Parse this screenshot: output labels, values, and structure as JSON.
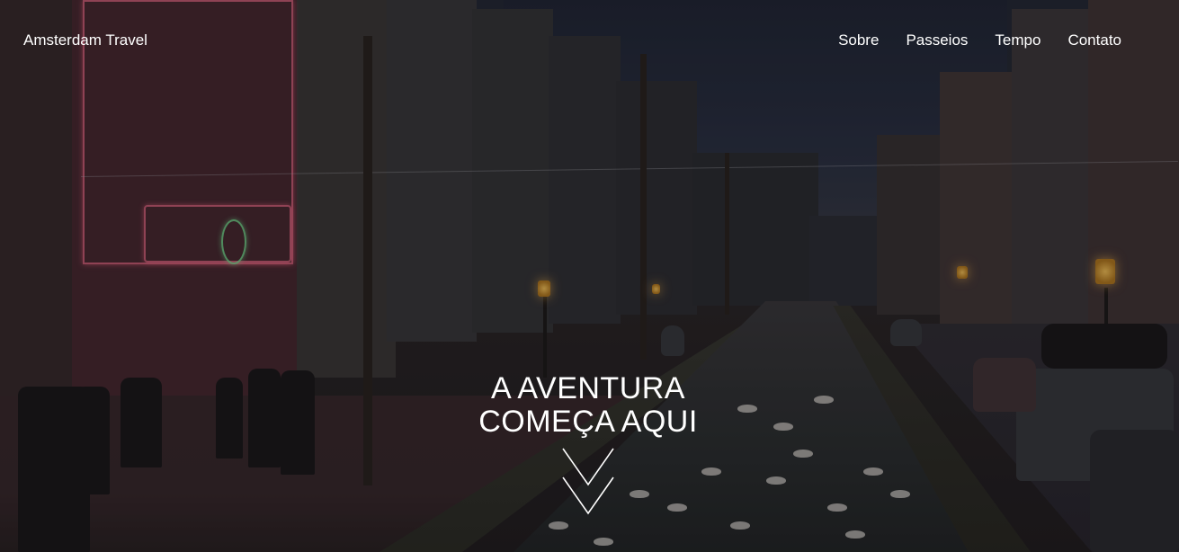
{
  "nav": {
    "brand": "Amsterdam Travel",
    "links": [
      "Sobre",
      "Passeios",
      "Tempo",
      "Contato"
    ]
  },
  "hero": {
    "headline_line1": "A AVENTURA",
    "headline_line2": "COMEÇA AQUI",
    "scroll_icon": "double-chevron-down-icon",
    "background_photo": "amsterdam-canal-night-photo"
  },
  "colors": {
    "text": "#ffffff",
    "overlay": "rgba(0,0,0,0.28)"
  }
}
